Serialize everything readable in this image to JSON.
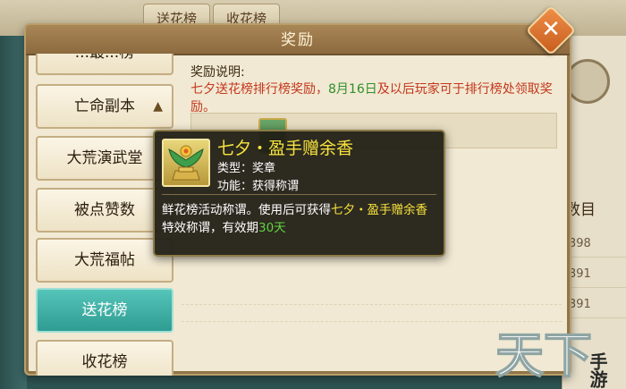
{
  "background": {
    "tabs": [
      "送花榜",
      "收花榜"
    ],
    "right_column_header": "数目",
    "right_column_values": [
      "398",
      "391",
      "391"
    ]
  },
  "dialog": {
    "title": "奖励",
    "close_icon": "close-icon"
  },
  "sidebar": {
    "items": [
      {
        "label": "...最...榜",
        "active": false
      },
      {
        "label": "亡命副本",
        "active": false
      },
      {
        "label": "大荒演武堂",
        "active": false
      },
      {
        "label": "被点赞数",
        "active": false
      },
      {
        "label": "大荒福帖",
        "active": false
      },
      {
        "label": "送花榜",
        "active": true
      },
      {
        "label": "收花榜",
        "active": false
      }
    ],
    "collapse_icon": "chevron-up-icon"
  },
  "reward": {
    "label": "奖励说明:",
    "desc_part1": "七夕送花榜排行榜奖励，",
    "desc_date": "8月16日",
    "desc_part2": "及以后玩家可于排行榜处领取奖励。"
  },
  "tooltip": {
    "title": "七夕・盈手赠余香",
    "type_line": "类型：奖章",
    "function_line": "功能：获得称谓",
    "desc_part1": "鲜花榜活动称谓。使用后可获得",
    "desc_highlight": "七夕・盈手赠余香",
    "desc_part2": "特效称谓，有效期",
    "desc_days": "30天"
  },
  "logo": {
    "text_main": "天下",
    "text_side": "手游"
  },
  "colors": {
    "accent_teal": "#2f9c92",
    "title_yellow": "#f7e33d",
    "desc_red": "#c4361c",
    "highlight_green": "#2f8f2a"
  }
}
